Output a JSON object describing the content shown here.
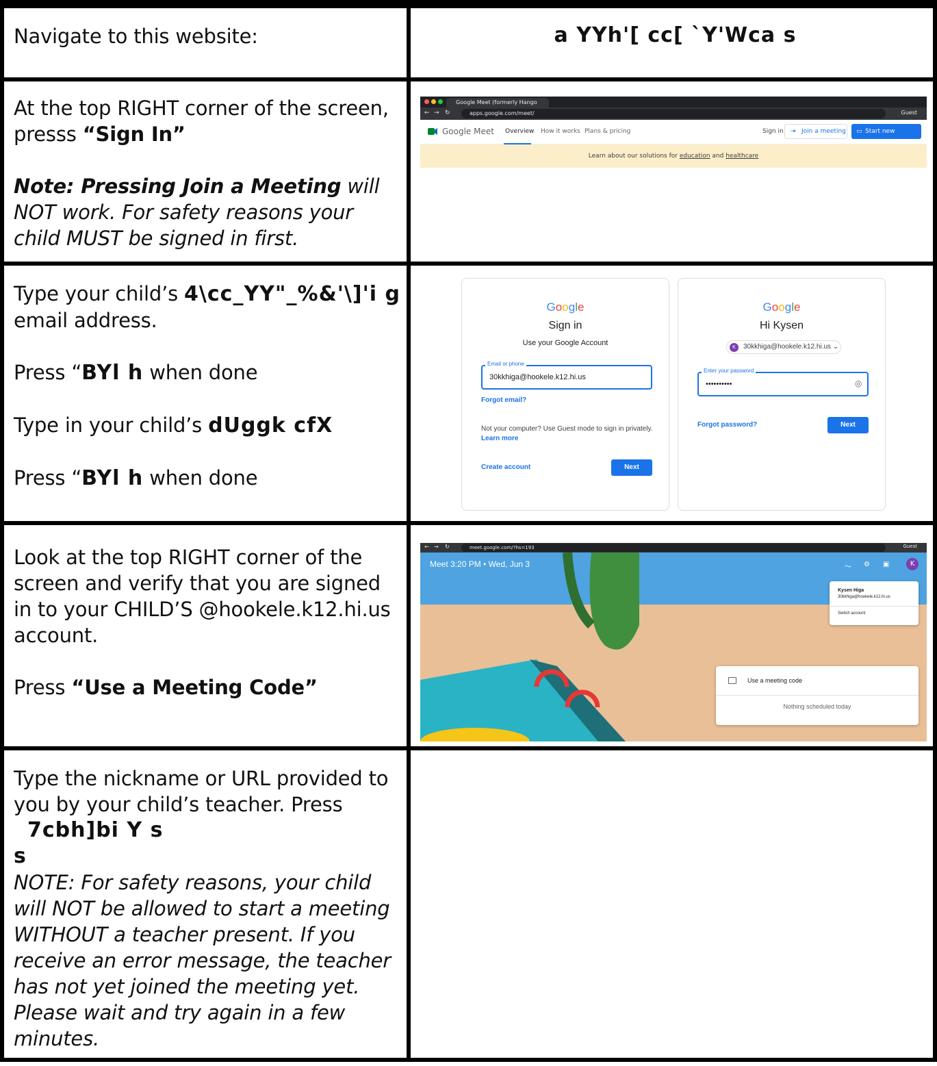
{
  "row1": {
    "left": "Navigate to this website:",
    "right": "a YYh'[ cc[ `Y'Wca s"
  },
  "row2": {
    "line1": "At the top RIGHT corner of the screen,",
    "line2_prefix": "presss ",
    "line2_bold": "“Sign In”",
    "note_bold_1": "Note: Pressing ",
    "note_bold_2": "Join a Meeting",
    "note_rest": " will NOT work. For safety reasons your child MUST be signed in first.",
    "screenshot": {
      "tab_title": "Google Meet (formerly Hango",
      "url": "apps.google.com/meet/",
      "guest": "Guest",
      "brand": "Google Meet",
      "nav": [
        "Overview",
        "How it works",
        "Plans & pricing"
      ],
      "sign_in": "Sign in",
      "join": "Join a meeting",
      "start": "Start new meeting",
      "banner_text": "Learn about our solutions for",
      "banner_link1": "education",
      "banner_and": "and",
      "banner_link2": "healthcare"
    }
  },
  "row3": {
    "p1_prefix": "Type your child’s ",
    "p1_garbled": "4\\cc_YY\"_%&'\\]'i g",
    "p1_suffix": "email address.",
    "p2_prefix": "Press “",
    "p2_garbled": "BYl h",
    "p2_suffix": " when done",
    "p3_prefix": "Type in your child’s ",
    "p3_garbled": "dUggk cfX",
    "p4_prefix": "Press “",
    "p4_garbled": "BYl h",
    "p4_suffix": " when done",
    "card1": {
      "logo": [
        "G",
        "o",
        "o",
        "g",
        "l",
        "e"
      ],
      "title": "Sign in",
      "subtitle": "Use your Google Account",
      "field_label": "Email or phone",
      "field_value": "30kkhiga@hookele.k12.hi.us",
      "forgot": "Forgot email?",
      "guest_note": "Not your computer? Use Guest mode to sign in privately.",
      "learn_more": "Learn more",
      "create": "Create account",
      "next": "Next"
    },
    "card2": {
      "logo": [
        "G",
        "o",
        "o",
        "g",
        "l",
        "e"
      ],
      "title": "Hi Kysen",
      "account": "30kkhiga@hookele.k12.hi.us",
      "avatar": "K",
      "field_label": "Enter your password",
      "field_value": "••••••••••",
      "forgot": "Forgot password?",
      "next": "Next"
    }
  },
  "row4": {
    "p1": "Look at the top RIGHT corner of the screen and verify that you are signed in to your CHILD’S @hookele.k12.hi.us account.",
    "p2_prefix": "Press ",
    "p2_bold": "“Use a Meeting Code”",
    "screenshot": {
      "url": "meet.google.com/?hs=193",
      "guest": "Guest",
      "meet_label": "Meet  3:20 PM  •  Wed, Jun 3",
      "avatar": "K",
      "popup_name": "Kysen Higa",
      "popup_email": "30kkhiga@hookele.k12.hi.us",
      "popup_switch": "Switch account",
      "use_code": "Use a meeting code",
      "nothing": "Nothing scheduled today"
    }
  },
  "row5": {
    "p1": "Type the nickname or URL provided to you by your child’s teacher. Press",
    "g1": "7cbh]bi Y s",
    "g2": "s",
    "note": "NOTE: For safety reasons, your child will NOT be allowed to start a meeting WITHOUT a teacher present.  If you receive an error message, the teacher has not yet joined the meeting yet. Please wait and try again in a few minutes."
  }
}
